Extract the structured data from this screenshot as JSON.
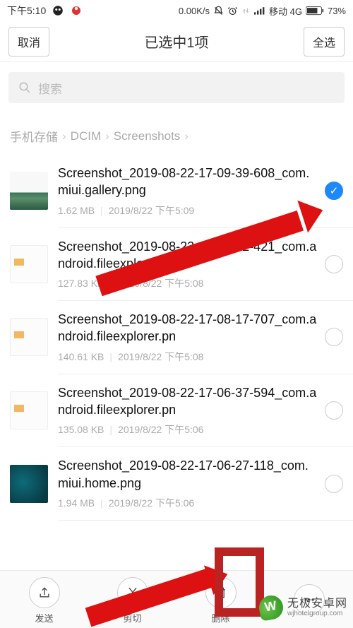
{
  "status": {
    "time": "下午5:10",
    "net_speed": "0.00K/s",
    "carrier": "移动 4G",
    "battery": "73%"
  },
  "header": {
    "cancel": "取消",
    "title": "已选中1项",
    "select_all": "全选"
  },
  "search": {
    "placeholder": "搜索"
  },
  "breadcrumb": {
    "items": [
      "手机存储",
      "DCIM",
      "Screenshots"
    ]
  },
  "files": [
    {
      "name": "Screenshot_2019-08-22-17-09-39-608_com.miui.gallery.png",
      "size": "1.62 MB",
      "date": "2019/8/22 下午5:09",
      "selected": true,
      "thumb": "gallery"
    },
    {
      "name": "Screenshot_2019-08-22-17-08-22-421_com.android.fileexplorer.pn",
      "size": "127.83 KB",
      "date": "2019/8/22 下午5:08",
      "selected": false,
      "thumb": "explorer"
    },
    {
      "name": "Screenshot_2019-08-22-17-08-17-707_com.android.fileexplorer.pn",
      "size": "140.61 KB",
      "date": "2019/8/22 下午5:08",
      "selected": false,
      "thumb": "explorer"
    },
    {
      "name": "Screenshot_2019-08-22-17-06-37-594_com.android.fileexplorer.pn",
      "size": "135.08 KB",
      "date": "2019/8/22 下午5:06",
      "selected": false,
      "thumb": "explorer"
    },
    {
      "name": "Screenshot_2019-08-22-17-06-27-118_com.miui.home.png",
      "size": "1.94 MB",
      "date": "2019/8/22 下午5:06",
      "selected": false,
      "thumb": "home"
    }
  ],
  "bottom": {
    "send": "发送",
    "cut": "剪切",
    "delete": "删除",
    "more": ""
  },
  "watermark": {
    "cn": "无极安卓网",
    "en": "wjhotelgroup.com"
  }
}
